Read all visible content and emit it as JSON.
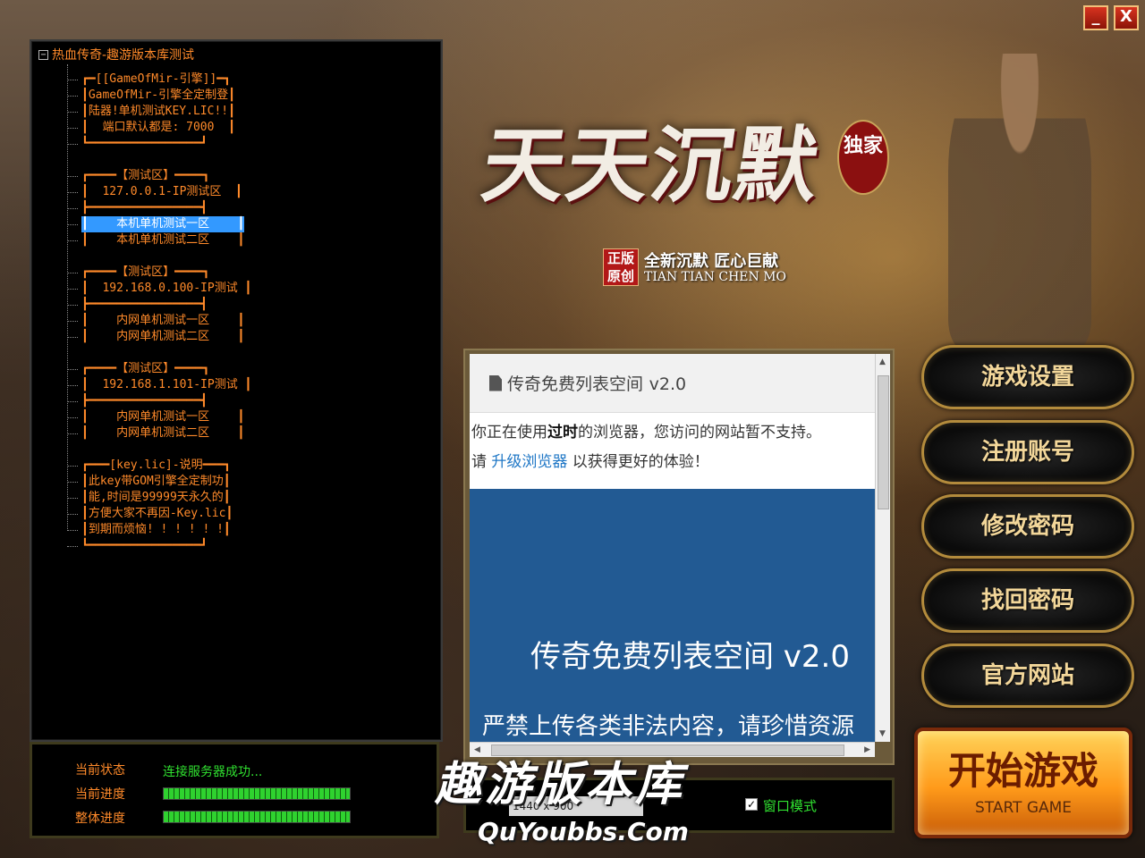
{
  "window": {
    "minimize_label": "_",
    "close_label": "X"
  },
  "logo": {
    "title": "天天沉默",
    "badge": "独家",
    "seal": "正版原创",
    "slogan": "全新沉默 匠心巨献",
    "pinyin": "TIAN TIAN CHEN MO"
  },
  "server_tree": {
    "root": "热血传奇-趣游版本库测试",
    "collapse_glyph": "−",
    "items": [
      "┏━[[GameOfMir-引擎]]━┓",
      "┃GameOfMir-引擎全定制登┃",
      "┃陆器!单机测试KEY.LIC!!┃",
      "┃  端口默认都是: 7000  ┃",
      "┗━━━━━━━━━━━━━━━━┛",
      "┏━━━━【测试区】━━━━┓",
      "┃  127.0.0.1-IP测试区  ┃",
      "┣━━━━━━━━━━━━━━━━┫",
      "┃    本机单机测试一区    ┃",
      "┃    本机单机测试二区    ┃",
      "┏━━━━【测试区】━━━━┓",
      "┃  192.168.0.100-IP测试 ┃",
      "┣━━━━━━━━━━━━━━━━┫",
      "┃    内网单机测试一区    ┃",
      "┃    内网单机测试二区    ┃",
      "┏━━━━【测试区】━━━━┓",
      "┃  192.168.1.101-IP测试 ┃",
      "┣━━━━━━━━━━━━━━━━┫",
      "┃    内网单机测试一区    ┃",
      "┃    内网单机测试二区    ┃",
      "┏━━━[key.lic]-说明━━━┓",
      "┃此key带GOM引擎全定制功┃",
      "┃能,时间是99999天永久的┃",
      "┃方便大家不再因-Key.lic┃",
      "┃到期而烦恼! ! ! ! ! !┃",
      "┗━━━━━━━━━━━━━━━━┛"
    ],
    "selected_index": 8
  },
  "status": {
    "state_label": "当前状态",
    "state_value": "连接服务器成功...",
    "progress_label": "当前进度",
    "total_label": "整体进度",
    "progress_percent": 100,
    "total_percent": 100
  },
  "browser": {
    "page_title_bold": "传奇免费列表空间",
    "page_title_version": "v2.0",
    "warn_line1_pre": "你正在使用",
    "warn_line1_bold": "过时",
    "warn_line1_post": "的浏览器，您访问的网站暂不支持。",
    "warn_line2_pre": "请 ",
    "warn_line2_link": "升级浏览器",
    "warn_line2_post": " 以获得更好的体验！",
    "hero_title": "传奇免费列表空间 v2.0",
    "hero_subtitle": "严禁上传各类非法内容，请珍惜资源"
  },
  "menu": {
    "game_settings": "游戏设置",
    "register": "注册账号",
    "change_password": "修改密码",
    "recover_password": "找回密码",
    "official_site": "官方网站",
    "start_cn": "开始游戏",
    "start_en": "START GAME"
  },
  "options": {
    "resolution": "1440 x 900",
    "window_mode_label": "窗口模式",
    "window_mode_checked": true,
    "check_glyph": "✓"
  },
  "watermark": {
    "cn": "趣游版本库",
    "en": "QuYoubbs.Com"
  }
}
